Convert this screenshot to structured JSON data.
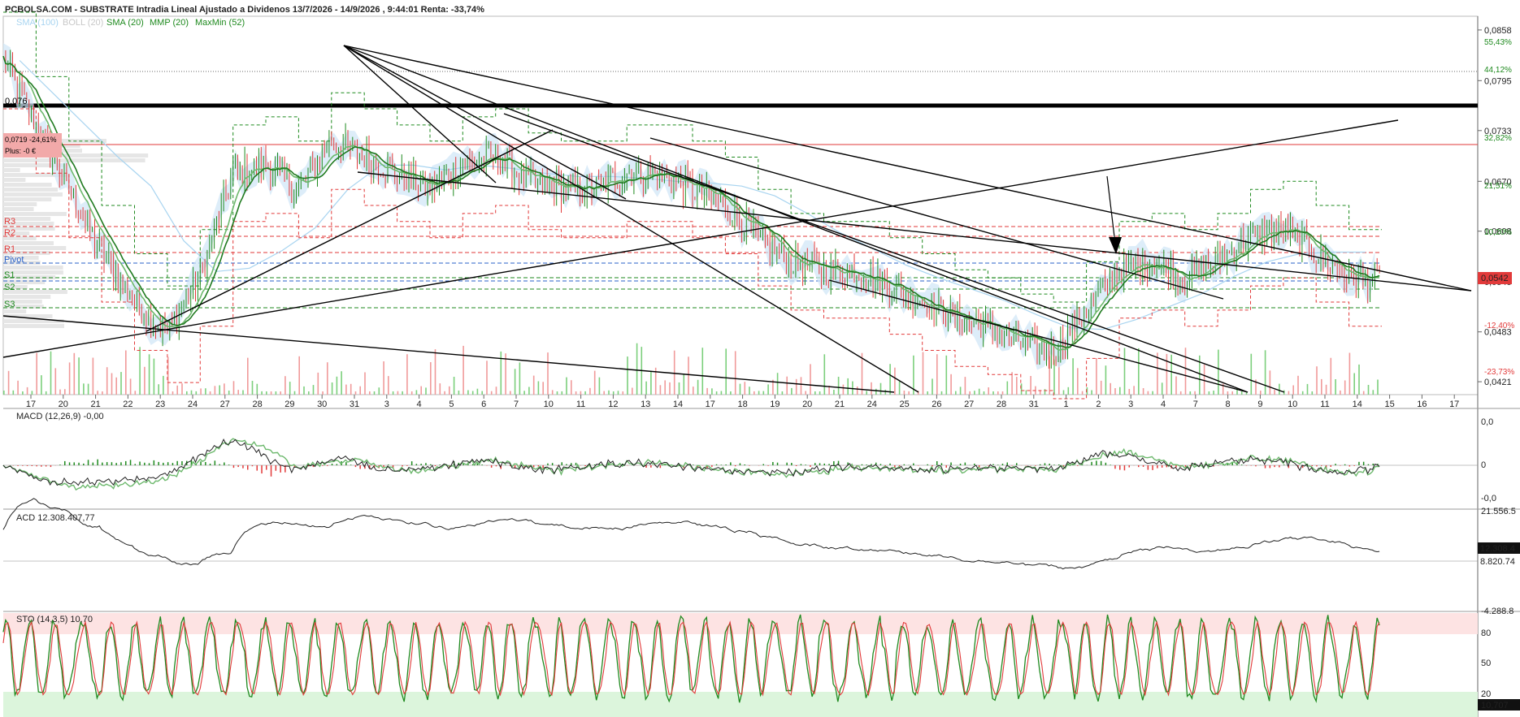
{
  "header": {
    "title": "PCBOLSA.COM - SUBSTRATE Intradia Lineal Ajustado a Dividenos 13/7/2026 - 14/9/2026 , 9:44:01 Renta: -33,74%",
    "legend": [
      {
        "label": "SMA (100)",
        "color": "#a8d4f0"
      },
      {
        "label": "BOLL (20)",
        "color": "#c8c8c8"
      },
      {
        "label": "SMA (20)",
        "color": "#1f8a1f"
      },
      {
        "label": "MMP (20)",
        "color": "#6cb86c"
      },
      {
        "label": "MaxMin (52)",
        "color": "#1f8a1f"
      }
    ]
  },
  "price_panel": {
    "y_ticks": [
      "0,0858",
      "0,0795",
      "0,0733",
      "0,0670",
      "0,0608",
      "0,0545",
      "0,0483",
      "0,0421"
    ],
    "y_pcts": [
      "55,43%",
      "44,12%",
      "32,82%",
      "21,51%",
      "10,20%",
      "-12,40%",
      "-23,73%"
    ],
    "last_price": "0,0542",
    "level_076_label": "0,076",
    "marker_label": "0,0719  -24,61%",
    "marker_sub": "Plus: -0 €",
    "pivot_labels": [
      "R3",
      "R2",
      "R1",
      "Pivot",
      "S1",
      "S2",
      "S3"
    ],
    "x_dates": [
      "17",
      "20",
      "21",
      "22",
      "23",
      "24",
      "27",
      "28",
      "29",
      "30",
      "31",
      "3",
      "4",
      "5",
      "6",
      "7",
      "10",
      "11",
      "12",
      "13",
      "14",
      "17",
      "18",
      "19",
      "20",
      "21",
      "24",
      "25",
      "26",
      "27",
      "28",
      "31",
      "1",
      "2",
      "3",
      "4",
      "7",
      "8",
      "9",
      "10",
      "11",
      "14",
      "15",
      "16",
      "17"
    ]
  },
  "macd_panel": {
    "label": "MACD (12,26,9)   -0,00",
    "y_ticks": [
      "0,0",
      "0",
      "-0,0"
    ]
  },
  "acd_panel": {
    "label": "ACD   12.308.407,77",
    "y_ticks": [
      "21.556.5",
      "12.308.4",
      "8.820.74",
      "-4.288.8"
    ]
  },
  "sto_panel": {
    "label": "STO (14,3,5)   10,70",
    "y_ticks": [
      "80",
      "50",
      "20"
    ],
    "last": "10,707"
  },
  "colors": {
    "up": "#1f8a1f",
    "down": "#e23a3a",
    "sma100": "#a8d4f0",
    "boll": "#cfe6f7",
    "trend": "#000000",
    "pivot_blue": "#2a62c9"
  },
  "chart_data": {
    "type": "line",
    "title": "SUBSTRATE Intradia",
    "x": [
      "17",
      "20",
      "21",
      "22",
      "23",
      "24",
      "27",
      "28",
      "29",
      "30",
      "31",
      "3",
      "4",
      "5",
      "6",
      "7",
      "10",
      "11",
      "12",
      "13",
      "14",
      "17",
      "18",
      "19",
      "20",
      "21",
      "24",
      "25",
      "26",
      "27",
      "28",
      "31",
      "1",
      "2",
      "3",
      "4",
      "7",
      "8",
      "9",
      "10",
      "11",
      "14"
    ],
    "series": [
      {
        "name": "SMA (20)",
        "values": [
          0.082,
          0.074,
          0.066,
          0.058,
          0.052,
          0.048,
          0.055,
          0.068,
          0.069,
          0.066,
          0.072,
          0.07,
          0.068,
          0.066,
          0.069,
          0.07,
          0.067,
          0.066,
          0.066,
          0.068,
          0.068,
          0.066,
          0.064,
          0.06,
          0.057,
          0.056,
          0.056,
          0.054,
          0.052,
          0.05,
          0.049,
          0.047,
          0.046,
          0.051,
          0.056,
          0.057,
          0.055,
          0.057,
          0.06,
          0.061,
          0.058,
          0.055
        ]
      }
    ],
    "ylim": [
      0.0405,
      0.0875
    ]
  }
}
